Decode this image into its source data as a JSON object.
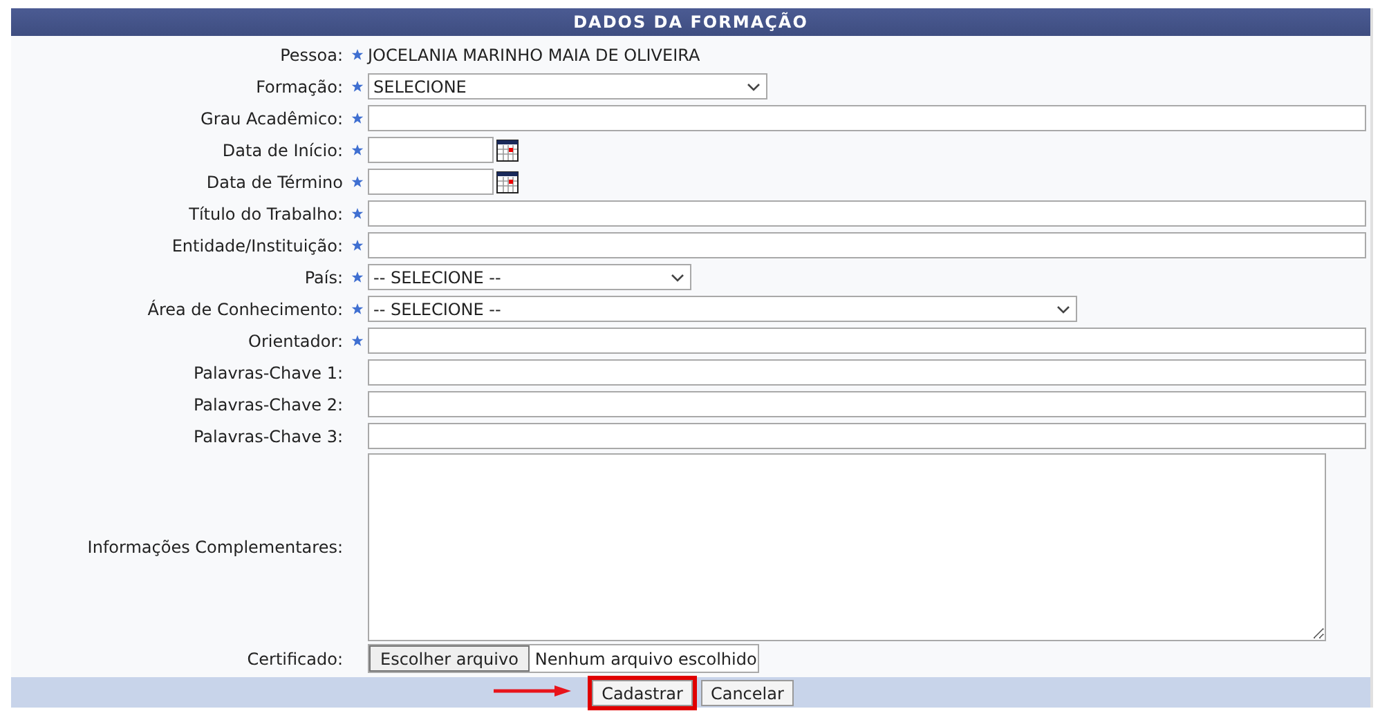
{
  "panel": {
    "title": "DADOS DA FORMAÇÃO"
  },
  "fields": [
    {
      "kind": "static",
      "label": "Pessoa:",
      "required": true,
      "value": "JOCELANIA MARINHO MAIA DE OLIVEIRA"
    },
    {
      "kind": "select",
      "label": "Formação:",
      "required": true,
      "value": "SELECIONE"
    },
    {
      "kind": "text",
      "label": "Grau Acadêmico:",
      "required": true
    },
    {
      "kind": "date",
      "label": "Data de Início:",
      "required": true
    },
    {
      "kind": "date",
      "label": "Data de Término",
      "required": true
    },
    {
      "kind": "text",
      "label": "Título do Trabalho:",
      "required": true
    },
    {
      "kind": "text",
      "label": "Entidade/Instituição:",
      "required": true
    },
    {
      "kind": "select",
      "label": "País:",
      "required": true,
      "value": "-- SELECIONE --"
    },
    {
      "kind": "select",
      "label": "Área de Conhecimento:",
      "required": true,
      "value": "-- SELECIONE --"
    },
    {
      "kind": "text",
      "label": "Orientador:",
      "required": true
    },
    {
      "kind": "text",
      "label": "Palavras-Chave 1:",
      "required": false
    },
    {
      "kind": "text",
      "label": "Palavras-Chave 2:",
      "required": false
    },
    {
      "kind": "text",
      "label": "Palavras-Chave 3:",
      "required": false
    },
    {
      "kind": "textarea",
      "label": "Informações Complementares:",
      "required": false
    },
    {
      "kind": "file",
      "label": "Certificado:",
      "required": false,
      "button": "Escolher arquivo",
      "value": "Nenhum arquivo escolhido"
    }
  ],
  "buttons": [
    {
      "label": "Cadastrar",
      "highlighted": true
    },
    {
      "label": "Cancelar",
      "highlighted": false
    }
  ]
}
